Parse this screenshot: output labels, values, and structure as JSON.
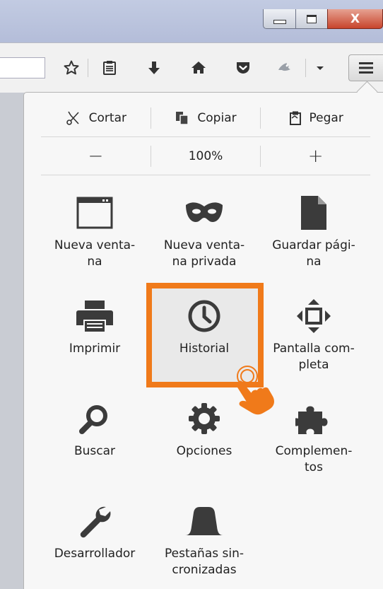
{
  "window": {
    "close_glyph": "X"
  },
  "toolbar": {
    "icons": [
      "star-icon",
      "reading-list-icon",
      "download-icon",
      "home-icon",
      "pocket-icon",
      "extension-icon",
      "dropdown-icon",
      "menu-icon"
    ]
  },
  "edit": {
    "cut": "Cortar",
    "copy": "Copiar",
    "paste": "Pegar"
  },
  "zoom": {
    "minus": "−",
    "level": "100%",
    "plus": "+"
  },
  "menu_items": {
    "new_window": [
      "Nueva venta-",
      "na"
    ],
    "private_window": [
      "Nueva venta-",
      "na privada"
    ],
    "save_page": [
      "Guardar pági-",
      "na"
    ],
    "print": [
      "Imprimir"
    ],
    "history": [
      "Historial"
    ],
    "fullscreen": [
      "Pantalla com-",
      "pleta"
    ],
    "find": [
      "Buscar"
    ],
    "options": [
      "Opciones"
    ],
    "addons": [
      "Complemen-",
      "tos"
    ],
    "developer": [
      "Desarrollador"
    ],
    "synced_tabs": [
      "Pestañas sin-",
      "cronizadas"
    ]
  },
  "colors": {
    "highlight": "#f07a1a",
    "icon": "#3b3b3b"
  }
}
